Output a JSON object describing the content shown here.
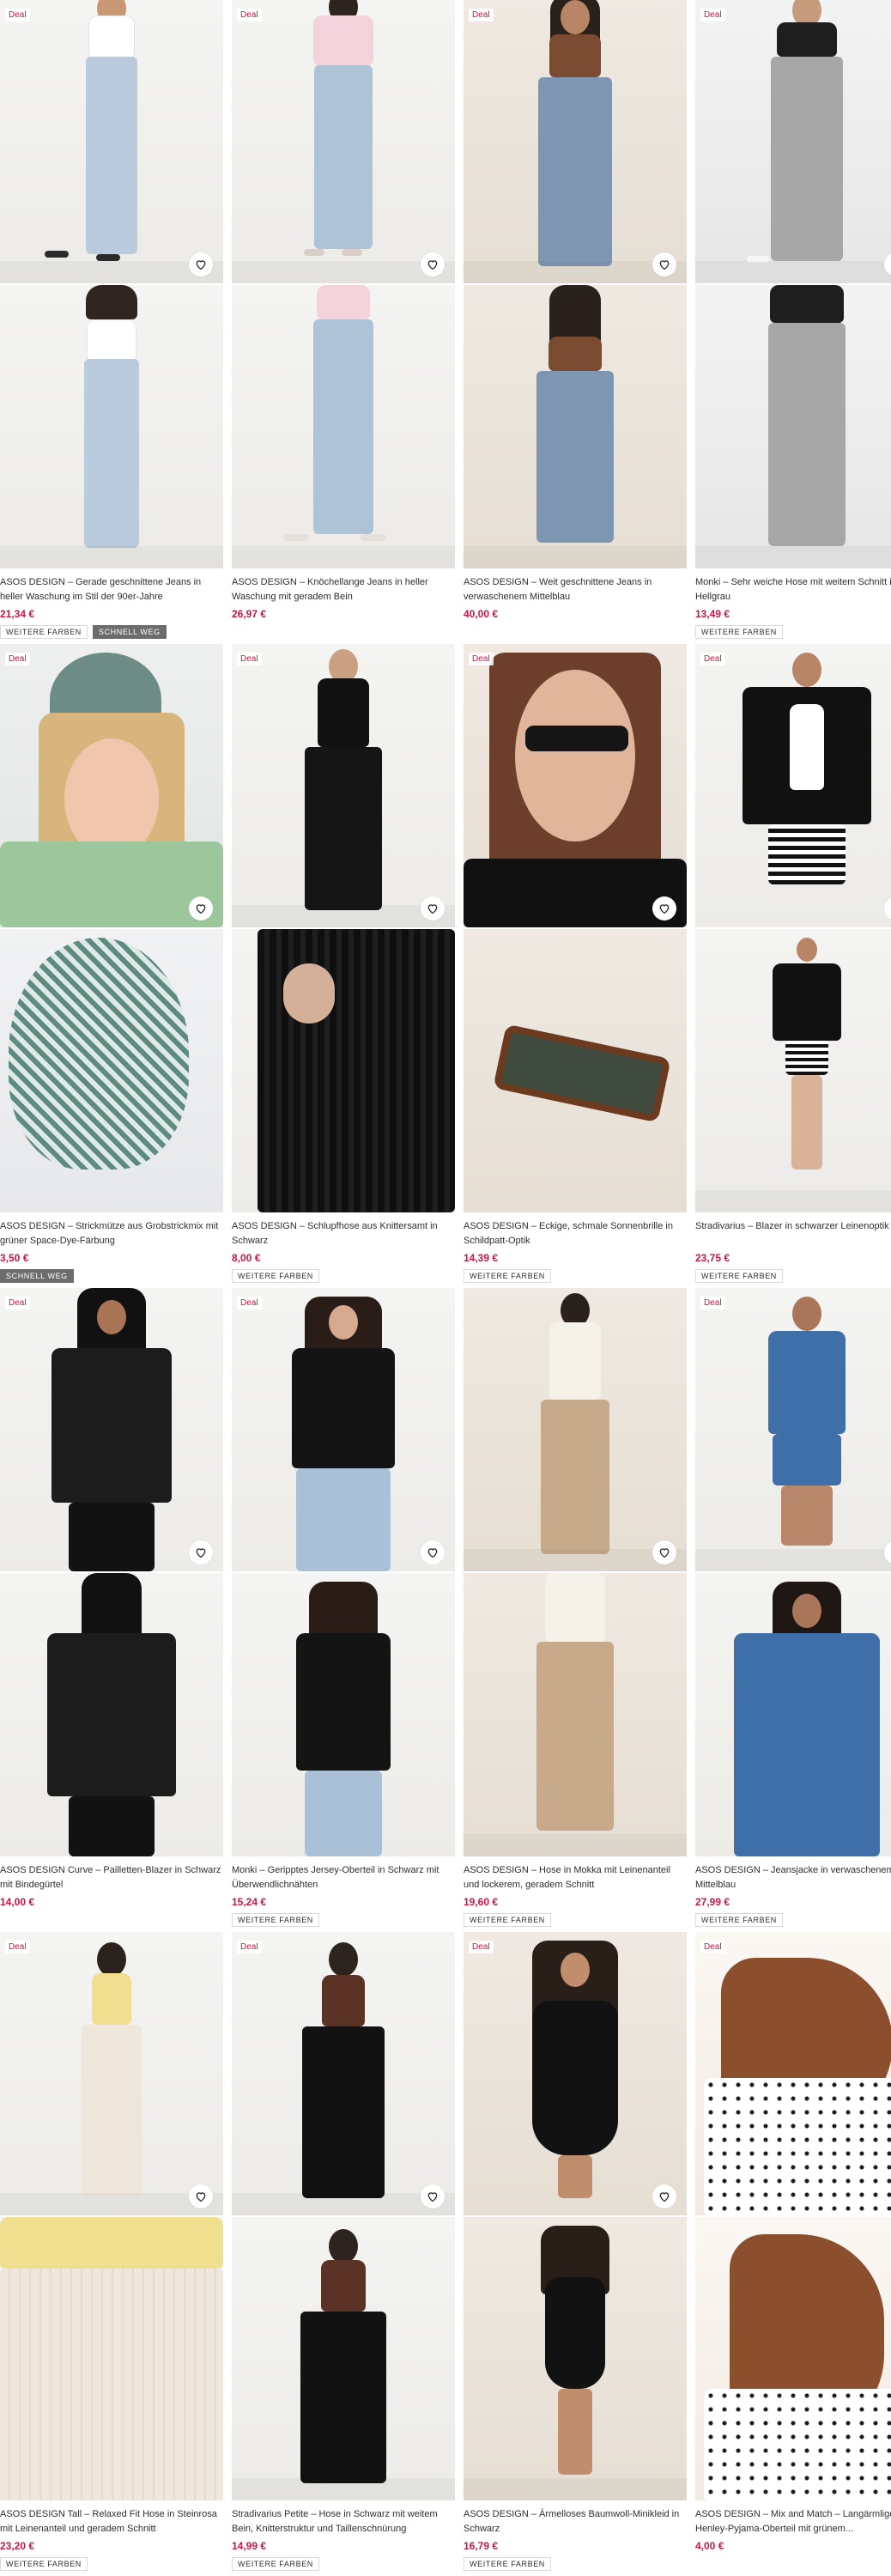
{
  "labels": {
    "deal": "Deal"
  },
  "products": [
    {
      "title": "ASOS DESIGN – Gerade geschnittene Jeans in heller Waschung im Stil der 90er-Jahre",
      "price": "21,34 €",
      "badges": [
        "WEITERE FARBEN",
        "SCHNELL WEG"
      ],
      "deal": true,
      "images": [
        "model-light-jeans-white-top-front",
        "model-light-jeans-white-top-back"
      ]
    },
    {
      "title": "ASOS DESIGN – Knöchellange Jeans in heller Waschung mit geradem Bein",
      "price": "26,97 €",
      "badges": [],
      "deal": true,
      "images": [
        "model-light-jeans-pink-tee-front",
        "model-light-jeans-detail"
      ]
    },
    {
      "title": "ASOS DESIGN – Weit geschnittene Jeans in verwaschenem Mittelblau",
      "price": "40,00 €",
      "badges": [],
      "deal": true,
      "images": [
        "model-wide-jeans-brown-top-front",
        "model-wide-jeans-brown-top-back"
      ]
    },
    {
      "title": "Monki – Sehr weiche Hose mit weitem Schnitt in Hellgrau",
      "price": "13,49 €",
      "badges": [
        "WEITERE FARBEN"
      ],
      "deal": true,
      "images": [
        "model-grey-trousers-front",
        "model-grey-trousers-back"
      ]
    },
    {
      "title": "ASOS DESIGN – Strickmütze aus Grobstrickmix mit grüner Space-Dye-Färbung",
      "price": "3,50 €",
      "badges": [
        "SCHNELL WEG"
      ],
      "deal": true,
      "images": [
        "model-green-beanie",
        "green-beanie-product"
      ]
    },
    {
      "title": "ASOS DESIGN – Schlupfhose aus Knittersamt in Schwarz",
      "price": "8,00 €",
      "badges": [
        "WEITERE FARBEN"
      ],
      "deal": true,
      "images": [
        "model-black-velvet-trousers",
        "black-velvet-detail"
      ]
    },
    {
      "title": "ASOS DESIGN – Eckige, schmale Sonnenbrille in Schildpatt-Optik",
      "price": "14,39 €",
      "badges": [
        "WEITERE FARBEN"
      ],
      "deal": true,
      "images": [
        "model-sunglasses",
        "tortoiseshell-sunglasses-product"
      ]
    },
    {
      "title": "Stradivarius – Blazer in schwarzer Leinenoptik",
      "price": "23,75 €",
      "badges": [
        "WEITERE FARBEN"
      ],
      "deal": true,
      "images": [
        "model-black-blazer-striped-shorts",
        "model-black-blazer-full"
      ]
    },
    {
      "title": "ASOS DESIGN Curve – Pailletten-Blazer in Schwarz mit Bindegürtel",
      "price": "14,00 €",
      "badges": [],
      "deal": true,
      "images": [
        "model-black-sequin-blazer-front",
        "model-black-sequin-blazer-side"
      ]
    },
    {
      "title": "Monki – Geripptes Jersey-Oberteil in Schwarz mit Überwendlichnähten",
      "price": "15,24 €",
      "badges": [
        "WEITERE FARBEN"
      ],
      "deal": true,
      "images": [
        "model-black-ribbed-top-front",
        "model-black-ribbed-top-side"
      ]
    },
    {
      "title": "ASOS DESIGN – Hose in Mokka mit Leinenanteil und lockerem, geradem Schnitt",
      "price": "19,60 €",
      "badges": [
        "WEITERE FARBEN"
      ],
      "deal": false,
      "images": [
        "model-mocha-linen-trousers-front",
        "model-mocha-linen-trousers-side"
      ]
    },
    {
      "title": "ASOS DESIGN – Jeansjacke in verwaschenem Mittelblau",
      "price": "27,99 €",
      "badges": [
        "WEITERE FARBEN"
      ],
      "deal": true,
      "images": [
        "model-denim-set-full",
        "model-denim-jacket-closeup"
      ]
    },
    {
      "title": "ASOS DESIGN Tall – Relaxed Fit Hose in Steinrosa mit Leinenanteil und geradem Schnitt",
      "price": "23,20 €",
      "badges": [
        "WEITERE FARBEN"
      ],
      "deal": true,
      "images": [
        "model-stone-linen-trousers-full",
        "stone-linen-trousers-detail"
      ]
    },
    {
      "title": "Stradivarius Petite – Hose in Schwarz mit weitem Bein, Knitterstruktur und Taillenschnürung",
      "price": "14,99 €",
      "badges": [
        "WEITERE FARBEN"
      ],
      "deal": true,
      "images": [
        "model-black-wide-trousers-front",
        "model-black-wide-trousers-full"
      ]
    },
    {
      "title": "ASOS DESIGN – Ärmelloses Baumwoll-Minikleid in Schwarz",
      "price": "16,79 €",
      "badges": [
        "WEITERE FARBEN"
      ],
      "deal": true,
      "images": [
        "model-black-mini-dress-front",
        "model-black-mini-dress-full"
      ]
    },
    {
      "title": "ASOS DESIGN – Mix and Match – Langärmliges Henley-Pyjama-Oberteil mit grünem...",
      "price": "4,00 €",
      "badges": [],
      "deal": true,
      "images": [
        "model-polka-dot-henley-back",
        "model-polka-dot-henley-side"
      ]
    }
  ]
}
